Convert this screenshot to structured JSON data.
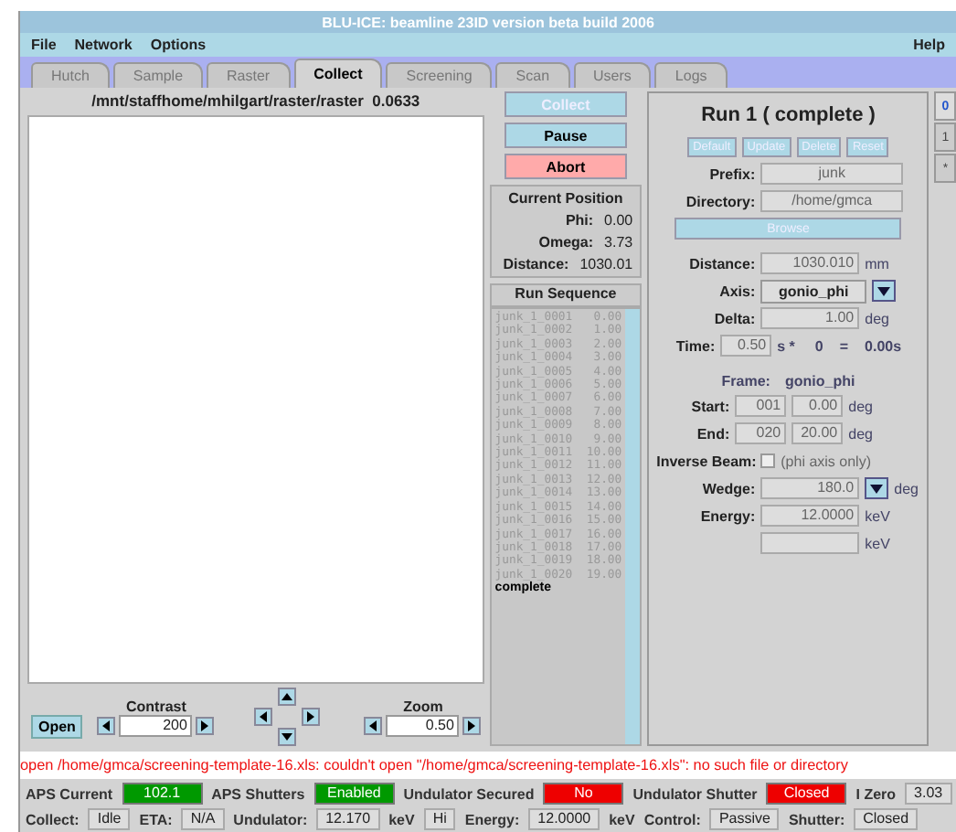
{
  "window": {
    "title": "BLU-ICE: beamline 23ID version beta build 2006"
  },
  "menu": [
    "File",
    "Network",
    "Options"
  ],
  "menu_right": "Help",
  "tabs": [
    {
      "label": "Hutch",
      "selected": false
    },
    {
      "label": "Sample",
      "selected": false
    },
    {
      "label": "Raster",
      "selected": false
    },
    {
      "label": "Collect",
      "selected": true
    },
    {
      "label": "Screening",
      "selected": false
    },
    {
      "label": "Scan",
      "selected": false
    },
    {
      "label": "Users",
      "selected": false
    },
    {
      "label": "Logs",
      "selected": false
    }
  ],
  "image_panel": {
    "path": "/mnt/staffhome/mhilgart/raster/raster  0.0633",
    "open_button": "Open",
    "contrast_label": "Contrast",
    "contrast": "200",
    "zoom_label": "Zoom",
    "zoom": "0.50"
  },
  "actions": [
    {
      "label": "Collect",
      "disabled": true,
      "kind": "normal"
    },
    {
      "label": "Pause",
      "disabled": false,
      "kind": "normal"
    },
    {
      "label": "Abort",
      "disabled": false,
      "kind": "danger"
    }
  ],
  "position": {
    "title": "Current Position",
    "rows": [
      {
        "label": "Phi:",
        "value": "0.00"
      },
      {
        "label": "Omega:",
        "value": "3.73"
      },
      {
        "label": "Distance:",
        "value": "1030.01"
      }
    ]
  },
  "run_sequence": {
    "title": "Run Sequence",
    "rows": [
      {
        "name": "junk_1_0001",
        "angle": "0.00"
      },
      {
        "name": "junk_1_0002",
        "angle": "1.00"
      },
      {
        "name": "junk_1_0003",
        "angle": "2.00"
      },
      {
        "name": "junk_1_0004",
        "angle": "3.00"
      },
      {
        "name": "junk_1_0005",
        "angle": "4.00"
      },
      {
        "name": "junk_1_0006",
        "angle": "5.00"
      },
      {
        "name": "junk_1_0007",
        "angle": "6.00"
      },
      {
        "name": "junk_1_0008",
        "angle": "7.00"
      },
      {
        "name": "junk_1_0009",
        "angle": "8.00"
      },
      {
        "name": "junk_1_0010",
        "angle": "9.00"
      },
      {
        "name": "junk_1_0011",
        "angle": "10.00"
      },
      {
        "name": "junk_1_0012",
        "angle": "11.00"
      },
      {
        "name": "junk_1_0013",
        "angle": "12.00"
      },
      {
        "name": "junk_1_0014",
        "angle": "13.00"
      },
      {
        "name": "junk_1_0015",
        "angle": "14.00"
      },
      {
        "name": "junk_1_0016",
        "angle": "15.00"
      },
      {
        "name": "junk_1_0017",
        "angle": "16.00"
      },
      {
        "name": "junk_1_0018",
        "angle": "17.00"
      },
      {
        "name": "junk_1_0019",
        "angle": "18.00"
      },
      {
        "name": "junk_1_0020",
        "angle": "19.00"
      }
    ],
    "footer": "complete"
  },
  "run": {
    "title": "Run 1 ( complete )",
    "buttons": [
      {
        "label": "Default",
        "disabled": true
      },
      {
        "label": "Update",
        "disabled": true
      },
      {
        "label": "Delete",
        "disabled": true
      },
      {
        "label": "Reset",
        "disabled": true
      }
    ],
    "prefix": {
      "label": "Prefix:",
      "value": "junk"
    },
    "directory": {
      "label": "Directory:",
      "value": "/home/gmca"
    },
    "browse": "Browse",
    "distance": {
      "label": "Distance:",
      "value": "1030.010",
      "unit": "mm"
    },
    "axis": {
      "label": "Axis:",
      "value": "gonio_phi"
    },
    "delta": {
      "label": "Delta:",
      "value": "1.00",
      "unit": "deg"
    },
    "time": {
      "label": "Time:",
      "value": "0.50",
      "unit": "s *",
      "count": "0",
      "equals": "=",
      "total": "0.00s"
    },
    "frame_header": {
      "label": "Frame:",
      "axis": "gonio_phi"
    },
    "start": {
      "label": "Start:",
      "frame": "001",
      "angle": "0.00",
      "unit": "deg"
    },
    "end": {
      "label": "End:",
      "frame": "020",
      "angle": "20.00",
      "unit": "deg"
    },
    "inverse_beam": {
      "label": "Inverse Beam:",
      "checked": false,
      "note": "(phi axis only)"
    },
    "wedge": {
      "label": "Wedge:",
      "value": "180.0",
      "unit": "deg"
    },
    "energies": [
      {
        "label": "Energy:",
        "value": "12.0000",
        "unit": "keV"
      },
      {
        "unit": "keV"
      }
    ]
  },
  "run_tabs": [
    {
      "label": "0",
      "selected": true
    },
    {
      "label": "1",
      "selected": false
    },
    {
      "label": "*",
      "selected": false
    }
  ],
  "error_message": "open /home/gmca/screening-template-16.xls: couldn't open \"/home/gmca/screening-template-16.xls\": no such file or directory",
  "status_indicators": [
    {
      "label": "APS Current",
      "value": "102.1",
      "color": "#009900"
    },
    {
      "label": "APS Shutters",
      "value": "Enabled",
      "color": "#009900"
    },
    {
      "label": "Undulator Secured",
      "value": "No",
      "color": "#ee0000"
    },
    {
      "label": "Undulator Shutter",
      "value": "Closed",
      "color": "#ee0000"
    }
  ],
  "izero": {
    "label": "I Zero",
    "value": "3.03"
  },
  "status_fields": [
    {
      "label": "Collect:",
      "value": "Idle"
    },
    {
      "label": "ETA:",
      "value": "N/A"
    },
    {
      "label": "Undulator:",
      "value": "12.170",
      "unit": "keV"
    },
    {
      "value": "Hi"
    },
    {
      "label": "Energy:",
      "value": "12.0000",
      "unit": "keV"
    },
    {
      "label": "Control:",
      "value": "Passive"
    },
    {
      "label": "Shutter:",
      "value": "Closed"
    }
  ]
}
